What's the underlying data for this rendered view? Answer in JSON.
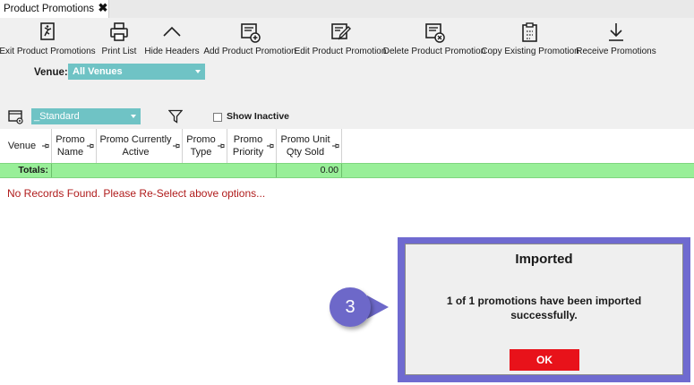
{
  "tab": {
    "title": "Product Promotions",
    "close_glyph": "✖"
  },
  "toolbar": {
    "buttons": [
      {
        "label": "Exit Product Promotions",
        "icon": "exit-icon"
      },
      {
        "label": "Print List",
        "icon": "printer-icon"
      },
      {
        "label": "Hide Headers",
        "icon": "chevron-up-icon"
      },
      {
        "label": "Add Product Promotion",
        "icon": "add-promotion-icon"
      },
      {
        "label": "Edit Product Promotion",
        "icon": "edit-promotion-icon"
      },
      {
        "label": "Delete Product Promotion",
        "icon": "delete-promotion-icon"
      },
      {
        "label": "Copy Existing Promotion",
        "icon": "copy-promotion-icon"
      },
      {
        "label": "Receive Promotions",
        "icon": "download-icon"
      }
    ]
  },
  "venue": {
    "label": "Venue:",
    "value": "All Venues"
  },
  "layout": {
    "value": "_Standard"
  },
  "show_inactive": {
    "label": "Show Inactive",
    "checked": false
  },
  "grid": {
    "columns": [
      "Venue",
      "Promo Name",
      "Promo Currently Active",
      "Promo Type",
      "Promo Priority",
      "Promo Unit Qty Sold"
    ],
    "totals_label": "Totals:",
    "totals_value": "0.00",
    "empty_message": "No Records Found. Please Re-Select above options..."
  },
  "step_badge": {
    "number": "3"
  },
  "dialog": {
    "title": "Imported",
    "message": "1 of 1 promotions have been imported successfully.",
    "ok_label": "OK"
  },
  "colors": {
    "select_bg": "#6fc3c5",
    "totals_bg": "#98ef98",
    "error_text": "#b01c1c",
    "badge": "#6d68c9",
    "ok_button": "#e8121a"
  }
}
